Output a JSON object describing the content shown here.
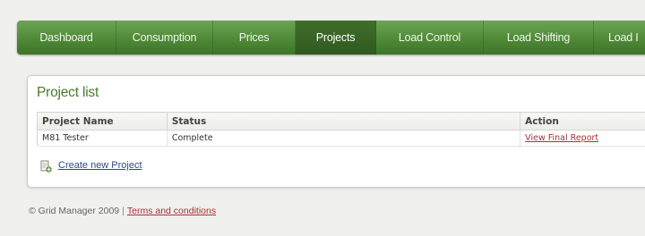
{
  "nav": {
    "items": [
      {
        "label": "Dashboard",
        "active": false
      },
      {
        "label": "Consumption",
        "active": false
      },
      {
        "label": "Prices",
        "active": false
      },
      {
        "label": "Projects",
        "active": true
      },
      {
        "label": "Load Control",
        "active": false
      },
      {
        "label": "Load Shifting",
        "active": false
      },
      {
        "label": "Load I",
        "active": false
      }
    ]
  },
  "panel": {
    "title": "Project list",
    "table": {
      "headers": [
        "Project Name",
        "Status",
        "Action"
      ],
      "rows": [
        {
          "name": "M81 Tester",
          "status": "Complete",
          "action": "View Final Report"
        }
      ]
    },
    "create": {
      "icon": "add-document-icon",
      "label": "Create new Project"
    }
  },
  "footer": {
    "copyright": "© Grid Manager 2009",
    "separator": "|",
    "terms_link": "Terms and conditions"
  },
  "colors": {
    "nav_green": "#4f8a37",
    "nav_active": "#2f5a1f",
    "title_green": "#4a7a2c",
    "link_red": "#a83232",
    "link_blue": "#2c4a80"
  }
}
